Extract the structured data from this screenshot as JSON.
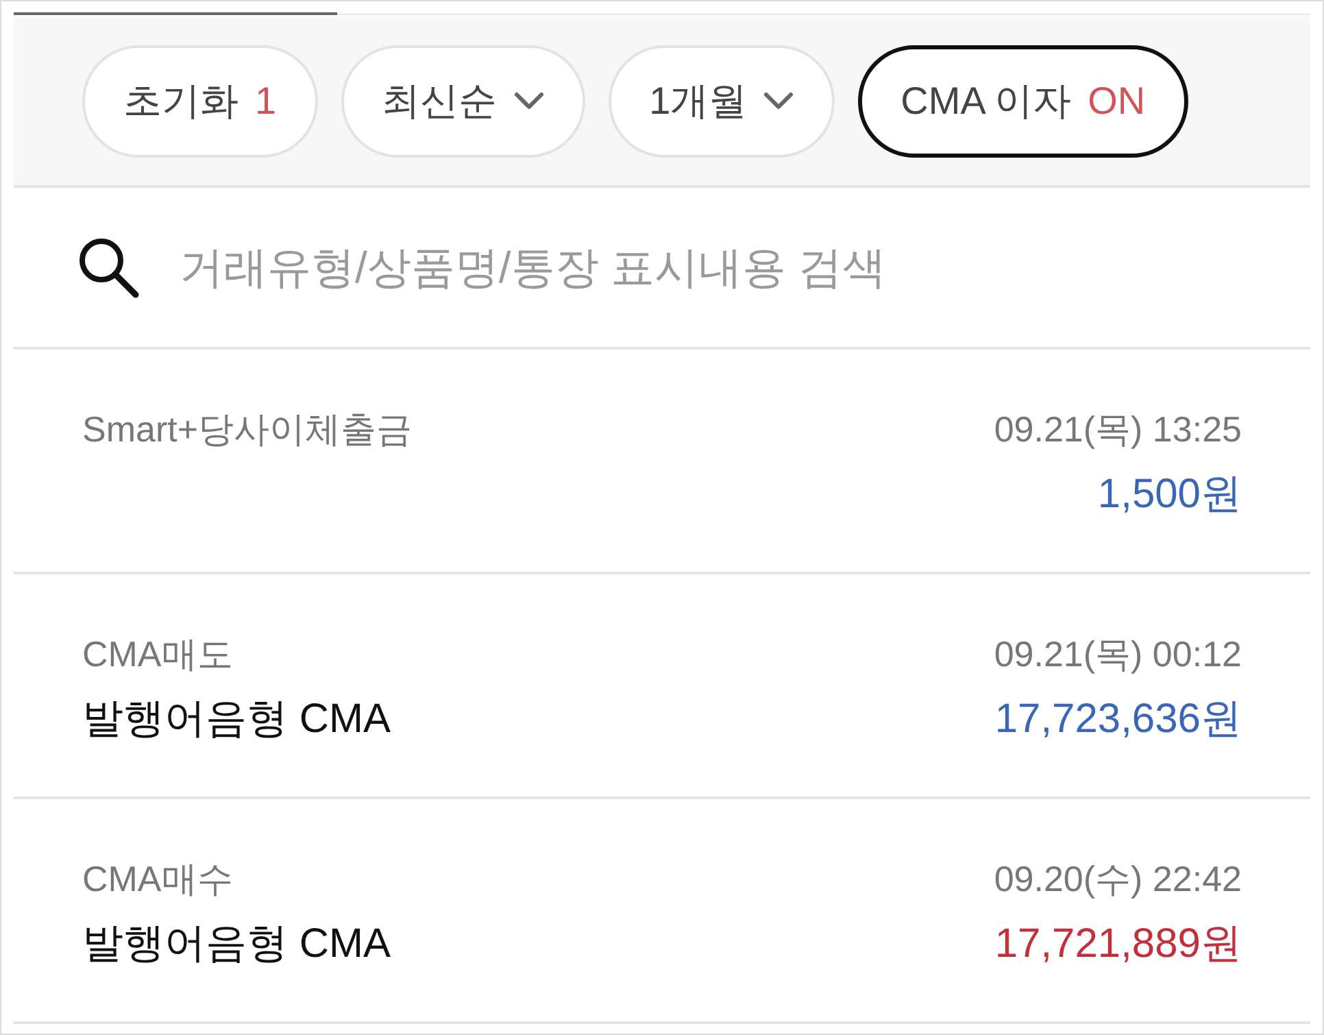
{
  "filters": [
    {
      "kind": "reset",
      "label": "초기화",
      "count": "1",
      "selected": false
    },
    {
      "kind": "dropdown",
      "label": "최신순",
      "selected": false
    },
    {
      "kind": "dropdown",
      "label": "1개월",
      "selected": false
    },
    {
      "kind": "toggle",
      "label": "CMA 이자",
      "value": "ON",
      "selected": true
    }
  ],
  "search": {
    "placeholder": "거래유형/상품명/통장 표시내용 검색"
  },
  "transactions": [
    {
      "type": "Smart+당사이체출금",
      "datetime": "09.21(목) 13:25",
      "amount": "1,500원",
      "color": "#3a66b8"
    },
    {
      "type": "CMA매도",
      "product": "발행어음형 CMA",
      "datetime": "09.21(목) 00:12",
      "amount": "17,723,636원",
      "color": "#3a66b8"
    },
    {
      "type": "CMA매수",
      "product": "발행어음형 CMA",
      "datetime": "09.20(수) 22:42",
      "amount": "17,721,889원",
      "color": "#c1303b"
    }
  ]
}
